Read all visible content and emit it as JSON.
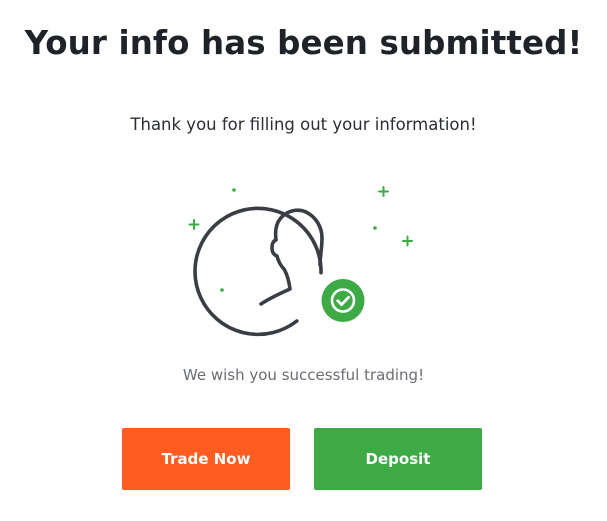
{
  "heading": "Your info has been submitted!",
  "subtitle": "Thank you for filling out your information!",
  "illustration": {
    "figure_icon": "user-silhouette-icon",
    "badge_icon": "check-circle-icon",
    "decor": "sparkle-icons"
  },
  "message": "We wish you successful trading!",
  "buttons": {
    "trade_now": "Trade Now",
    "deposit": "Deposit"
  },
  "colors": {
    "text_dark": "#1f2229",
    "text_muted": "#6a6d74",
    "icon_stroke": "#3a3d45",
    "success_green": "#3daa46",
    "trade_orange": "#ff5c21",
    "deposit_green": "#3daa46"
  }
}
